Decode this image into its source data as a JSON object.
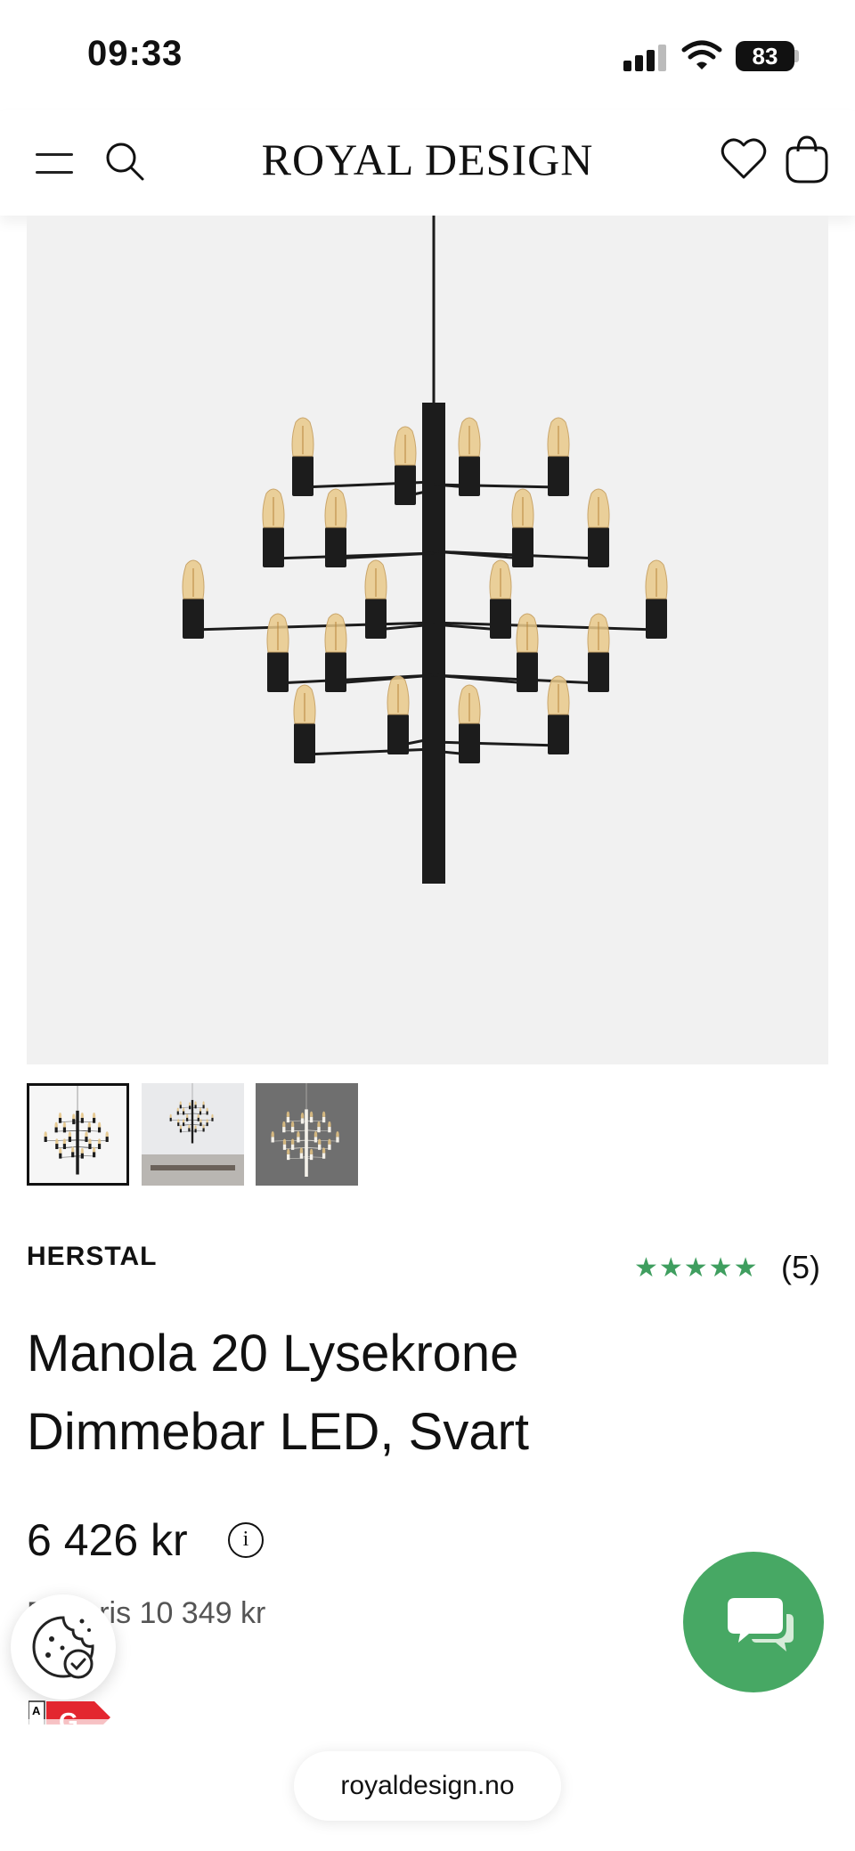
{
  "status_bar": {
    "time": "09:33",
    "battery": "83"
  },
  "header": {
    "logo": "ROYAL DESIGN"
  },
  "product": {
    "brand": "HERSTAL",
    "rating_stars": "★★★★★",
    "rating": 5,
    "review_count": "(5)",
    "title": "Manola 20 Lysekrone Dimmebar LED, Svart",
    "price": "6 426 kr",
    "original_price": "Før pris 10 349 kr",
    "energy_class": "G",
    "thumbnails": [
      "thumbnail-1",
      "thumbnail-2",
      "thumbnail-3"
    ],
    "selected_thumbnail": 0
  },
  "browser": {
    "url": "royaldesign.no"
  },
  "colors": {
    "accent_green": "#47a864",
    "star_green": "#3f9e5f",
    "energy_red": "#e3262f"
  },
  "icons": [
    "menu-icon",
    "search-icon",
    "heart-icon",
    "bag-icon",
    "info-icon",
    "cookie-icon",
    "chat-icon"
  ]
}
